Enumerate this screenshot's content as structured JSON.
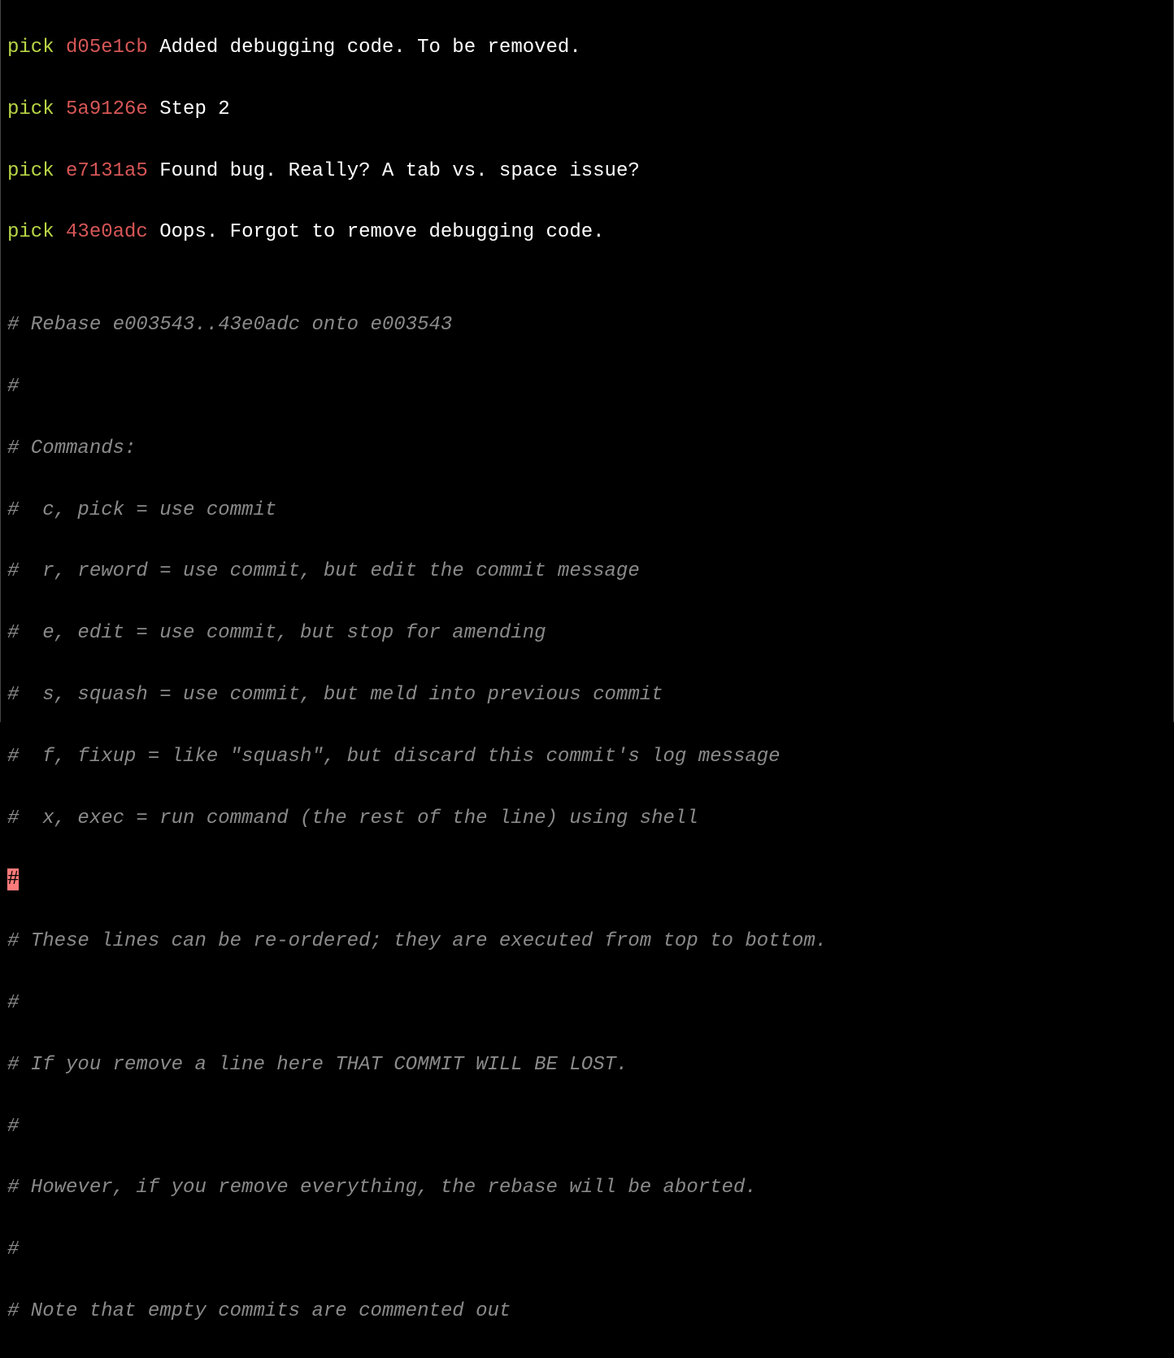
{
  "commits": [
    {
      "action": "pick",
      "hash": "d05e1cb",
      "message": "Added debugging code. To be removed."
    },
    {
      "action": "pick",
      "hash": "5a9126e",
      "message": "Step 2"
    },
    {
      "action": "pick",
      "hash": "e7131a5",
      "message": "Found bug. Really? A tab vs. space issue?"
    },
    {
      "action": "pick",
      "hash": "43e0adc",
      "message": "Oops. Forgot to remove debugging code."
    }
  ],
  "comments": {
    "blank": "",
    "rebaseHeader": "# Rebase e003543..43e0adc onto e003543",
    "hash": "#",
    "commandsHeader": "# Commands:",
    "cmd_pick": "#  c, pick = use commit",
    "cmd_reword": "#  r, reword = use commit, but edit the commit message",
    "cmd_edit": "#  e, edit = use commit, but stop for amending",
    "cmd_squash": "#  s, squash = use commit, but meld into previous commit",
    "cmd_fixup": "#  f, fixup = like \"squash\", but discard this commit's log message",
    "cmd_exec": "#  x, exec = run command (the rest of the line) using shell",
    "cursorChar": "#",
    "reorder": "# These lines can be re-ordered; they are executed from top to bottom.",
    "removeLine": "# If you remove a line here THAT COMMIT WILL BE LOST.",
    "abort": "# However, if you remove everything, the rebase will be aborted.",
    "emptyNote": "# Note that empty commits are commented out"
  }
}
